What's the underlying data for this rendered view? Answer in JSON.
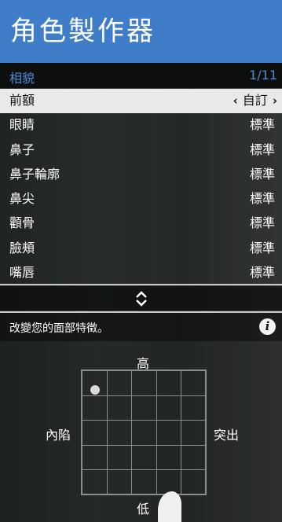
{
  "header": {
    "title": "角色製作器"
  },
  "subheader": {
    "section": "相貌",
    "page": "1/11"
  },
  "menu": {
    "selected": {
      "label": "前額",
      "value": "自訂",
      "left_arrow": "‹",
      "right_arrow": "›"
    },
    "items": [
      {
        "label": "眼睛",
        "value": "標準"
      },
      {
        "label": "鼻子",
        "value": "標準"
      },
      {
        "label": "鼻子輪廓",
        "value": "標準"
      },
      {
        "label": "鼻尖",
        "value": "標準"
      },
      {
        "label": "顴骨",
        "value": "標準"
      },
      {
        "label": "臉頰",
        "value": "標準"
      },
      {
        "label": "嘴唇",
        "value": "標準"
      }
    ]
  },
  "description": {
    "text": "改變您的面部特徵。",
    "info_icon": "i"
  },
  "grid": {
    "top_label": "高",
    "bottom_label": "低",
    "left_label": "內陷",
    "right_label": "突出"
  },
  "colors": {
    "header_bg": "#3f7dc8",
    "subheader_text": "#4a8bd8",
    "selected_bg": "#e9e9e9"
  }
}
